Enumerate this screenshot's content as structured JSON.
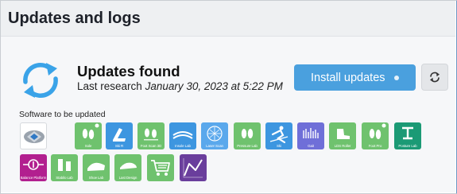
{
  "header": {
    "title": "Updates and logs"
  },
  "status": {
    "title": "Updates found",
    "last_research_prefix": "Last research",
    "last_research_date": "January 30, 2023 at 5:22 PM",
    "icon": "sync-icon"
  },
  "actions": {
    "install_label": "Install updates",
    "refresh_icon": "refresh-icon"
  },
  "software": {
    "label": "Software to be updated",
    "tiles": [
      {
        "name": "software-tile-globe",
        "caption": "",
        "color": "#ffffff",
        "icon": "globe-icon"
      },
      {
        "name": "software-tile-feet",
        "caption": "Sole",
        "color": "#6fc26e",
        "icon": "footprints-icon"
      },
      {
        "name": "software-tile-ski",
        "caption": "Ski R",
        "color": "#3d96e0",
        "icon": "ski-boot-icon"
      },
      {
        "name": "software-tile-feet-scan",
        "caption": "Foot Scan 3D",
        "color": "#6fc26e",
        "icon": "footprints-icon"
      },
      {
        "name": "software-tile-insole",
        "caption": "Insole Lab",
        "color": "#3d96e0",
        "icon": "insole-icon"
      },
      {
        "name": "software-tile-wave",
        "caption": "Laser Scan",
        "color": "#5aa8ec",
        "icon": "wave-icon"
      },
      {
        "name": "software-tile-feet-pressure",
        "caption": "Pressure Lab",
        "color": "#6fc26e",
        "icon": "footprints-icon"
      },
      {
        "name": "software-tile-skier",
        "caption": "Ski",
        "color": "#3d96e0",
        "icon": "skier-icon"
      },
      {
        "name": "software-tile-lines",
        "caption": "Gait",
        "color": "#6f6fd8",
        "icon": "signal-icon"
      },
      {
        "name": "software-tile-boot",
        "caption": "LDS Roller",
        "color": "#6fc26e",
        "icon": "boot-icon"
      },
      {
        "name": "software-tile-feet-pro",
        "caption": "Foot Pro",
        "color": "#6fc26e",
        "icon": "footprints-icon"
      },
      {
        "name": "software-tile-posture",
        "caption": "Posture Lab",
        "color": "#1b9a75",
        "icon": "posture-icon"
      },
      {
        "name": "software-tile-balance",
        "caption": "Balance Platform",
        "color": "#b21f8f",
        "icon": "balance-icon"
      },
      {
        "name": "software-tile-bars",
        "caption": "Stabilo Lab",
        "color": "#6fc26e",
        "icon": "bars-icon"
      },
      {
        "name": "software-tile-shoe",
        "caption": "Shoe Lab",
        "color": "#6fc26e",
        "icon": "shoe-icon"
      },
      {
        "name": "software-tile-last",
        "caption": "Last Design",
        "color": "#6fc26e",
        "icon": "last-icon"
      },
      {
        "name": "software-tile-cart",
        "caption": "",
        "color": "#6fc26e",
        "icon": "cart-icon"
      },
      {
        "name": "software-tile-graph",
        "caption": "",
        "color": "#6a3e9c",
        "icon": "graph-icon"
      }
    ]
  }
}
